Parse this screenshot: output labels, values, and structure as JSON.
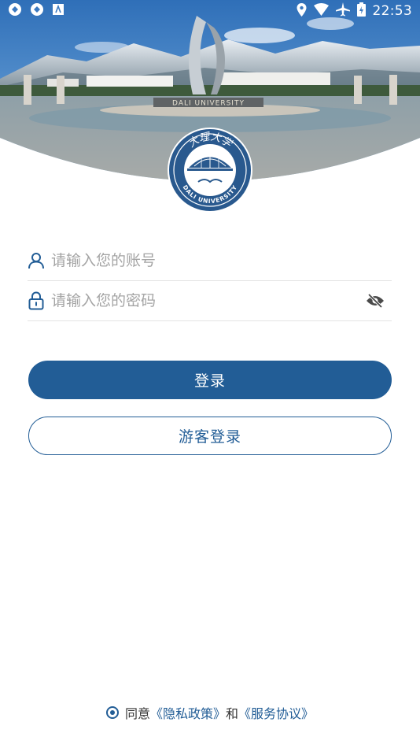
{
  "status_bar": {
    "time": "22:53",
    "left_icons": [
      "sync-icon",
      "sync-icon",
      "app-notification-icon"
    ],
    "right_icons": [
      "location-icon",
      "wifi-icon",
      "airplane-icon",
      "battery-icon"
    ]
  },
  "header": {
    "campus_sign_text": "DALI UNIVERSITY",
    "logo": {
      "top_text": "大理大学",
      "bottom_text": "DALI UNIVERSITY"
    }
  },
  "login_form": {
    "account_placeholder": "请输入您的账号",
    "password_placeholder": "请输入您的密码",
    "login_button": "登录",
    "guest_button": "游客登录"
  },
  "agreement": {
    "prefix": "同意",
    "privacy_link": "《隐私政策》",
    "conjunction": "和",
    "service_link": "《服务协议》"
  },
  "colors": {
    "primary": "#225d96",
    "placeholder": "#a4a4a4",
    "divider": "#e3e3e3"
  }
}
